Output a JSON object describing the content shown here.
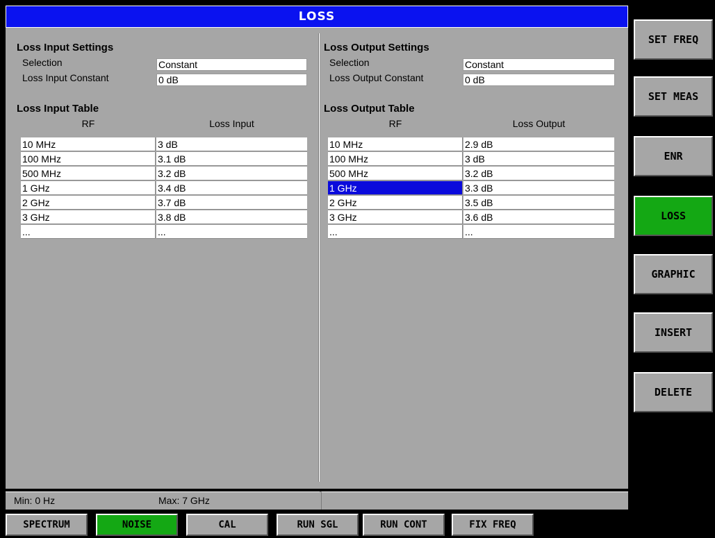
{
  "title": "LOSS",
  "input": {
    "settings_title": "Loss Input Settings",
    "selection_label": "Selection",
    "selection_value": "Constant",
    "constant_label": "Loss Input Constant",
    "constant_value": "0 dB",
    "table_title": "Loss Input Table",
    "col_rf": "RF",
    "col_loss": "Loss Input",
    "rows": [
      {
        "rf": "10 MHz",
        "loss": "3 dB"
      },
      {
        "rf": "100 MHz",
        "loss": "3.1 dB"
      },
      {
        "rf": "500 MHz",
        "loss": "3.2 dB"
      },
      {
        "rf": "1 GHz",
        "loss": "3.4 dB"
      },
      {
        "rf": "2 GHz",
        "loss": "3.7 dB"
      },
      {
        "rf": "3 GHz",
        "loss": "3.8 dB"
      },
      {
        "rf": "...",
        "loss": "..."
      }
    ]
  },
  "output": {
    "settings_title": "Loss Output Settings",
    "selection_label": "Selection",
    "selection_value": "Constant",
    "constant_label": "Loss Output Constant",
    "constant_value": "0 dB",
    "table_title": "Loss Output Table",
    "col_rf": "RF",
    "col_loss": "Loss Output",
    "rows": [
      {
        "rf": "10 MHz",
        "loss": "2.9 dB"
      },
      {
        "rf": "100 MHz",
        "loss": "3 dB"
      },
      {
        "rf": "500 MHz",
        "loss": "3.2 dB"
      },
      {
        "rf": "1 GHz",
        "loss": "3.3 dB"
      },
      {
        "rf": "2 GHz",
        "loss": "3.5 dB"
      },
      {
        "rf": "3 GHz",
        "loss": "3.6 dB"
      },
      {
        "rf": "...",
        "loss": "..."
      }
    ],
    "selected_row": 3
  },
  "status": {
    "min": "Min: 0 Hz",
    "max": "Max: 7 GHz"
  },
  "softkeys": [
    "SET FREQ",
    "SET MEAS",
    "ENR",
    "LOSS",
    "GRAPHIC",
    "INSERT",
    "DELETE"
  ],
  "active_softkey": "LOSS",
  "hotkeys": [
    "SPECTRUM",
    "NOISE",
    "CAL",
    "RUN SGL",
    "RUN CONT",
    "FIX FREQ"
  ],
  "active_hotkey": "NOISE",
  "colors": {
    "title_bar": "#0a12f0",
    "active_key": "#14a814",
    "panel_bg": "#a6a6a6",
    "selection": "#0a0adc"
  }
}
